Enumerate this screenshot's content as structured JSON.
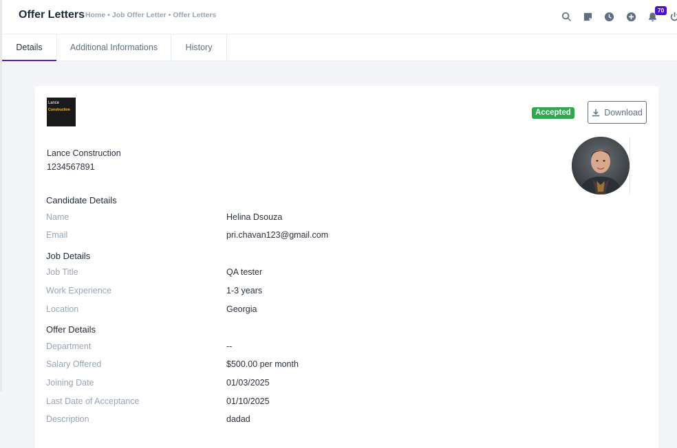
{
  "header": {
    "title": "Offer Letters",
    "breadcrumb": [
      "Home",
      "Job Offer Letter",
      "Offer Letters"
    ],
    "notification_count": "70"
  },
  "tabs": [
    {
      "label": "Details",
      "active": true
    },
    {
      "label": "Additional Informations",
      "active": false
    },
    {
      "label": "History",
      "active": false
    }
  ],
  "company": {
    "logo_text_top": "Lance",
    "logo_text_bottom": "Construction",
    "name": "Lance Construction",
    "phone": "1234567891"
  },
  "status": {
    "label": "Accepted",
    "color": "#2fa84f"
  },
  "download_label": "Download",
  "candidate": {
    "heading": "Candidate Details",
    "fields": [
      {
        "label": "Name",
        "value": "Helina Dsouza"
      },
      {
        "label": "Email",
        "value": "pri.chavan123@gmail.com"
      }
    ]
  },
  "job": {
    "heading": "Job Details",
    "fields": [
      {
        "label": "Job Title",
        "value": "QA tester"
      },
      {
        "label": "Work Experience",
        "value": "1-3 years"
      },
      {
        "label": "Location",
        "value": "Georgia"
      }
    ]
  },
  "offer": {
    "heading": "Offer Details",
    "fields": [
      {
        "label": "Department",
        "value": "--"
      },
      {
        "label": "Salary Offered",
        "value": "$500.00 per month"
      },
      {
        "label": "Joining Date",
        "value": "01/03/2025"
      },
      {
        "label": "Last Date of Acceptance",
        "value": "01/10/2025"
      },
      {
        "label": "Description",
        "value": "dadad"
      }
    ]
  },
  "colors": {
    "accent": "#5a24b4",
    "badge": "#4b0dd1"
  }
}
